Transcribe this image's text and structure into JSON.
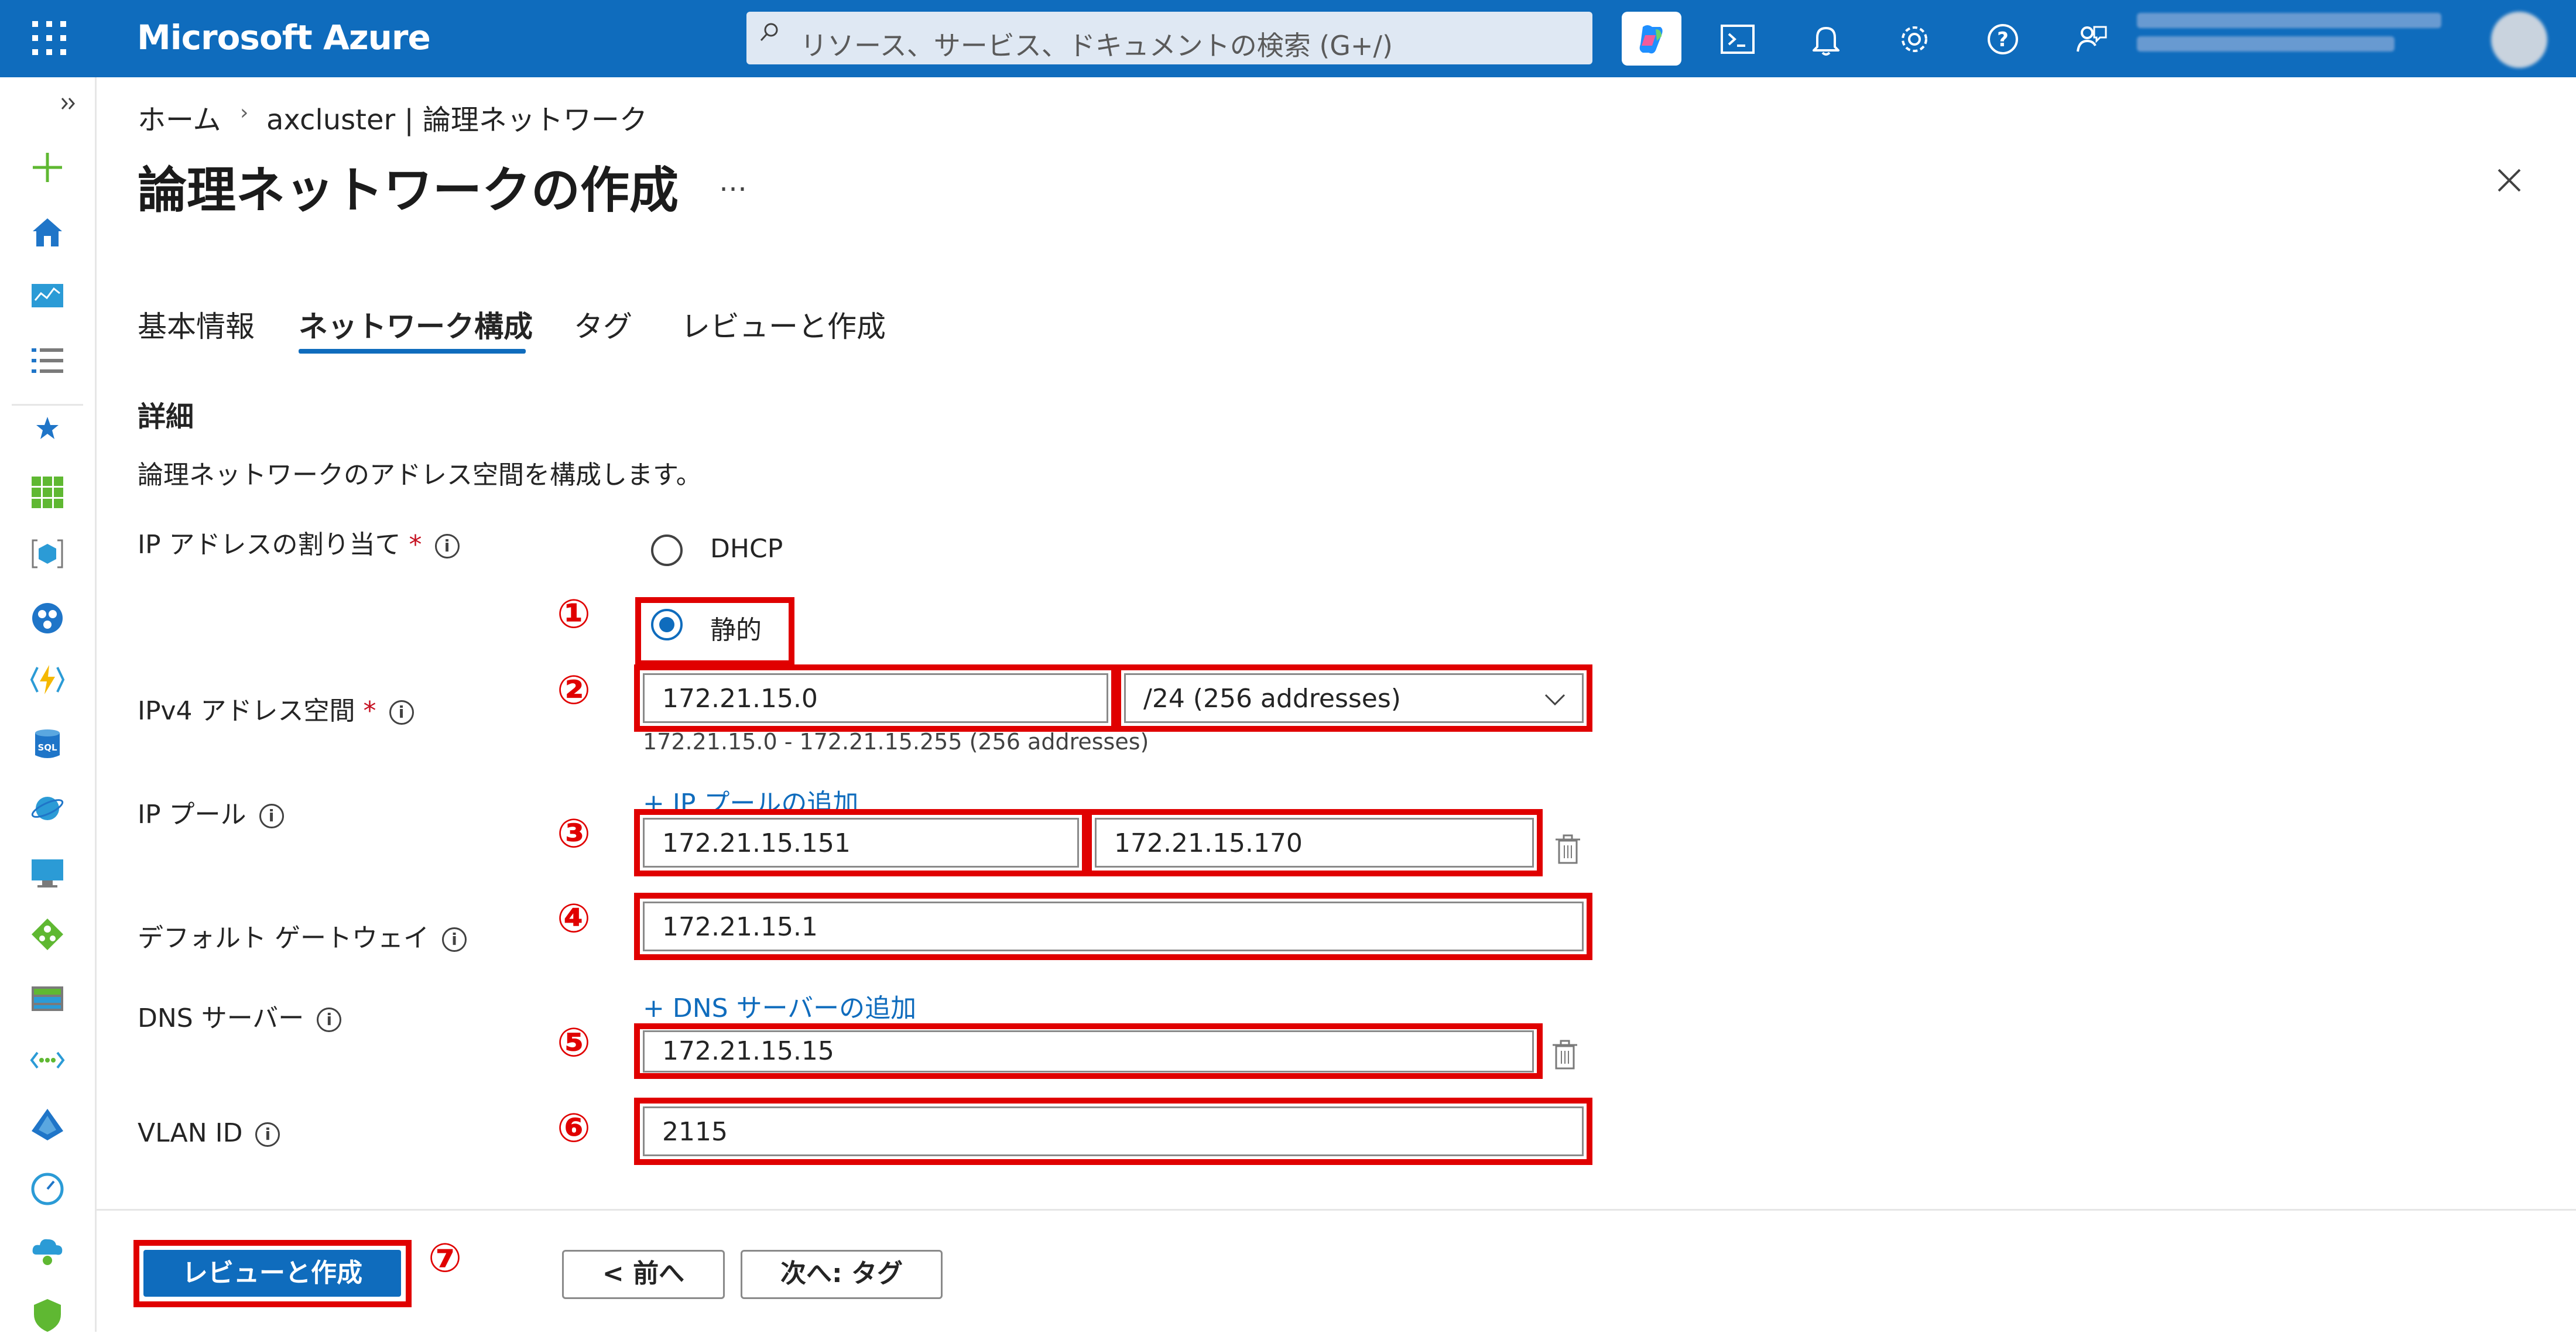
{
  "app": {
    "brand": "Microsoft Azure",
    "search_placeholder": "リソース、サービス、ドキュメントの検索 (G+/)"
  },
  "breadcrumb": {
    "home": "ホーム",
    "separator": "›",
    "current": "axcluster | 論理ネットワーク"
  },
  "page": {
    "title": "論理ネットワークの作成",
    "more": "…"
  },
  "tabs": [
    {
      "label": "基本情報",
      "active": false
    },
    {
      "label": "ネットワーク構成",
      "active": true
    },
    {
      "label": "タグ",
      "active": false
    },
    {
      "label": "レビューと作成",
      "active": false
    }
  ],
  "details": {
    "section_title": "詳細",
    "description": "論理ネットワークのアドレス空間を構成します。"
  },
  "form": {
    "ip_assignment": {
      "label": "IP アドレスの割り当て",
      "required_mark": "*",
      "options": [
        {
          "label": "DHCP",
          "selected": false
        },
        {
          "label": "静的",
          "selected": true
        }
      ]
    },
    "ipv4_space": {
      "label": "IPv4 アドレス空間",
      "required_mark": "*",
      "address": "172.21.15.0",
      "prefix": "/24 (256 addresses)",
      "range_hint": "172.21.15.0 - 172.21.15.255 (256 addresses)"
    },
    "ip_pool": {
      "label": "IP プール",
      "add_link": "+ IP プールの追加",
      "start": "172.21.15.151",
      "end": "172.21.15.170"
    },
    "gateway": {
      "label": "デフォルト ゲートウェイ",
      "value": "172.21.15.1"
    },
    "dns": {
      "label": "DNS サーバー",
      "add_link": "+ DNS サーバーの追加",
      "value": "172.21.15.15"
    },
    "vlan": {
      "label": "VLAN ID",
      "value": "2115"
    }
  },
  "annotations": [
    "①",
    "②",
    "③",
    "④",
    "⑤",
    "⑥",
    "⑦"
  ],
  "footer": {
    "create": "レビューと作成",
    "prev": "< 前へ",
    "next": "次へ: タグ"
  },
  "colors": {
    "accent": "#0f6cbd",
    "annotation_red": "#e00000"
  }
}
